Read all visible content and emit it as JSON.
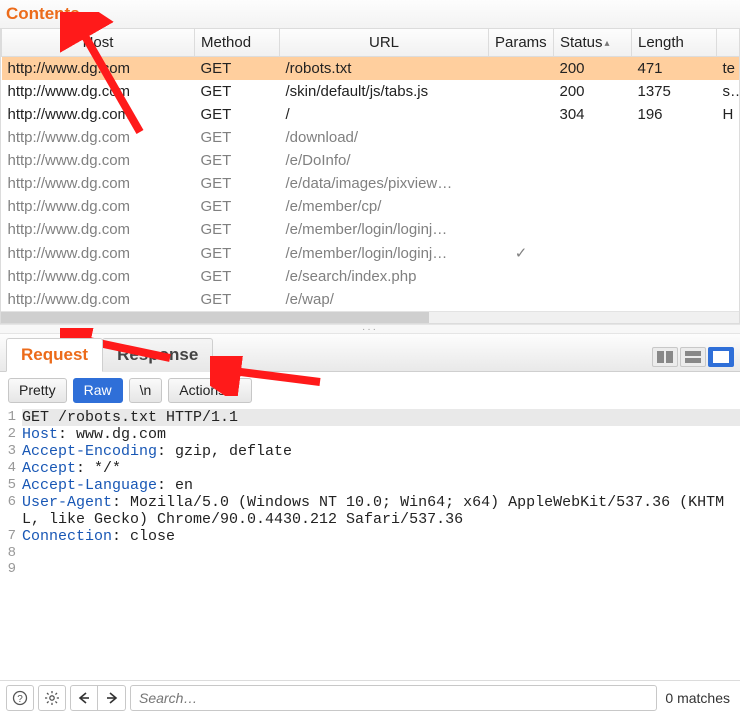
{
  "panel_title": "Contents",
  "columns": {
    "host": "Host",
    "method": "Method",
    "url": "URL",
    "params": "Params",
    "status": "Status",
    "length": "Length"
  },
  "rows": [
    {
      "host": "http://www.dg.com",
      "method": "GET",
      "url": "/robots.txt",
      "params": "",
      "status": "200",
      "length": "471",
      "extra": "te",
      "selected": true,
      "dim": false
    },
    {
      "host": "http://www.dg.com",
      "method": "GET",
      "url": "/skin/default/js/tabs.js",
      "params": "",
      "status": "200",
      "length": "1375",
      "extra": "sc",
      "selected": false,
      "dim": false
    },
    {
      "host": "http://www.dg.com",
      "method": "GET",
      "url": "/",
      "params": "",
      "status": "304",
      "length": "196",
      "extra": "H",
      "selected": false,
      "dim": false
    },
    {
      "host": "http://www.dg.com",
      "method": "GET",
      "url": "/download/",
      "params": "",
      "status": "",
      "length": "",
      "extra": "",
      "selected": false,
      "dim": true
    },
    {
      "host": "http://www.dg.com",
      "method": "GET",
      "url": "/e/DoInfo/",
      "params": "",
      "status": "",
      "length": "",
      "extra": "",
      "selected": false,
      "dim": true
    },
    {
      "host": "http://www.dg.com",
      "method": "GET",
      "url": "/e/data/images/pixview…",
      "params": "",
      "status": "",
      "length": "",
      "extra": "",
      "selected": false,
      "dim": true
    },
    {
      "host": "http://www.dg.com",
      "method": "GET",
      "url": "/e/member/cp/",
      "params": "",
      "status": "",
      "length": "",
      "extra": "",
      "selected": false,
      "dim": true
    },
    {
      "host": "http://www.dg.com",
      "method": "GET",
      "url": "/e/member/login/loginj…",
      "params": "",
      "status": "",
      "length": "",
      "extra": "",
      "selected": false,
      "dim": true
    },
    {
      "host": "http://www.dg.com",
      "method": "GET",
      "url": "/e/member/login/loginj…",
      "params": "✓",
      "status": "",
      "length": "",
      "extra": "",
      "selected": false,
      "dim": true
    },
    {
      "host": "http://www.dg.com",
      "method": "GET",
      "url": "/e/search/index.php",
      "params": "",
      "status": "",
      "length": "",
      "extra": "",
      "selected": false,
      "dim": true
    },
    {
      "host": "http://www.dg.com",
      "method": "GET",
      "url": "/e/wap/",
      "params": "",
      "status": "",
      "length": "",
      "extra": "",
      "selected": false,
      "dim": true
    }
  ],
  "tabs": {
    "request": "Request",
    "response": "Response"
  },
  "sub_toolbar": {
    "pretty": "Pretty",
    "raw": "Raw",
    "newline": "\\n",
    "actions": "Actions"
  },
  "request_lines": [
    {
      "n": "1",
      "headers": [],
      "text": "GET /robots.txt HTTP/1.1",
      "first": true
    },
    {
      "n": "2",
      "headers": [
        "Host"
      ],
      "text": "Host: www.dg.com"
    },
    {
      "n": "3",
      "headers": [
        "Accept-Encoding"
      ],
      "text": "Accept-Encoding: gzip, deflate"
    },
    {
      "n": "4",
      "headers": [
        "Accept"
      ],
      "text": "Accept: */*"
    },
    {
      "n": "5",
      "headers": [
        "Accept-Language"
      ],
      "text": "Accept-Language: en"
    },
    {
      "n": "6",
      "headers": [
        "User-Agent"
      ],
      "text": "User-Agent: Mozilla/5.0 (Windows NT 10.0; Win64; x64) AppleWebKit/537.36 (KHTML, like Gecko) Chrome/90.0.4430.212 Safari/537.36"
    },
    {
      "n": "7",
      "headers": [
        "Connection"
      ],
      "text": "Connection: close"
    },
    {
      "n": "8",
      "headers": [],
      "text": ""
    },
    {
      "n": "9",
      "headers": [],
      "text": ""
    }
  ],
  "footer": {
    "search_placeholder": "Search…",
    "matches": "0 matches"
  },
  "colors": {
    "accent_orange": "#ec6b1a",
    "accent_blue": "#2f6fd8",
    "selected_row": "#ffcf9e",
    "arrow_red": "#ff1a1a"
  }
}
